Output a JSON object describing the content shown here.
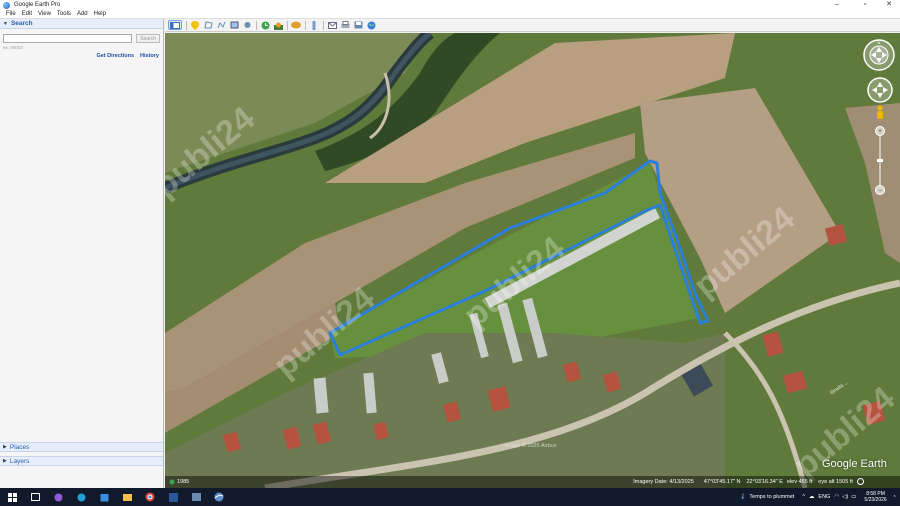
{
  "window": {
    "title": "Google Earth Pro",
    "minimize": "–",
    "maximize": "▫",
    "close": "✕"
  },
  "menu": [
    "File",
    "Edit",
    "View",
    "Tools",
    "Add",
    "Help"
  ],
  "toolbar": {
    "icons": [
      "sidebar-toggle-icon",
      "placemark-icon",
      "polygon-icon",
      "path-icon",
      "image-overlay-icon",
      "record-tour-icon",
      "historical-imagery-icon",
      "sun-icon",
      "planets-icon",
      "ruler-icon",
      "email-icon",
      "print-icon",
      "save-image-icon",
      "maps-icon"
    ]
  },
  "sidebar": {
    "search_header": "Search",
    "search_placeholder": "",
    "search_button": "Search",
    "search_hint": "ex: 94043",
    "get_directions": "Get Directions",
    "history": "History",
    "places_header": "Places",
    "layers_header": "Layers"
  },
  "map": {
    "imagery_credit": "Image © 2025 Airbus",
    "road_label": "Strada ...",
    "watermark_text": "publi24",
    "logo": "Google Earth",
    "status": {
      "year": "1985",
      "imagery_date": "Imagery Date: 4/13/2025",
      "lat": "47°03'45.17\" N",
      "lon": "22°03'16.34\" E",
      "elev": "elev 465 ft",
      "eye_alt": "eye alt 1505 ft"
    }
  },
  "taskbar": {
    "weather": "Temps to plummet",
    "language": "ENG",
    "time": "8:58 PM",
    "date": "5/23/2026"
  },
  "colors": {
    "outline": "#2a7fd8",
    "sidebar_header_text": "#2a5ea8",
    "taskbar": "#101a2a"
  }
}
